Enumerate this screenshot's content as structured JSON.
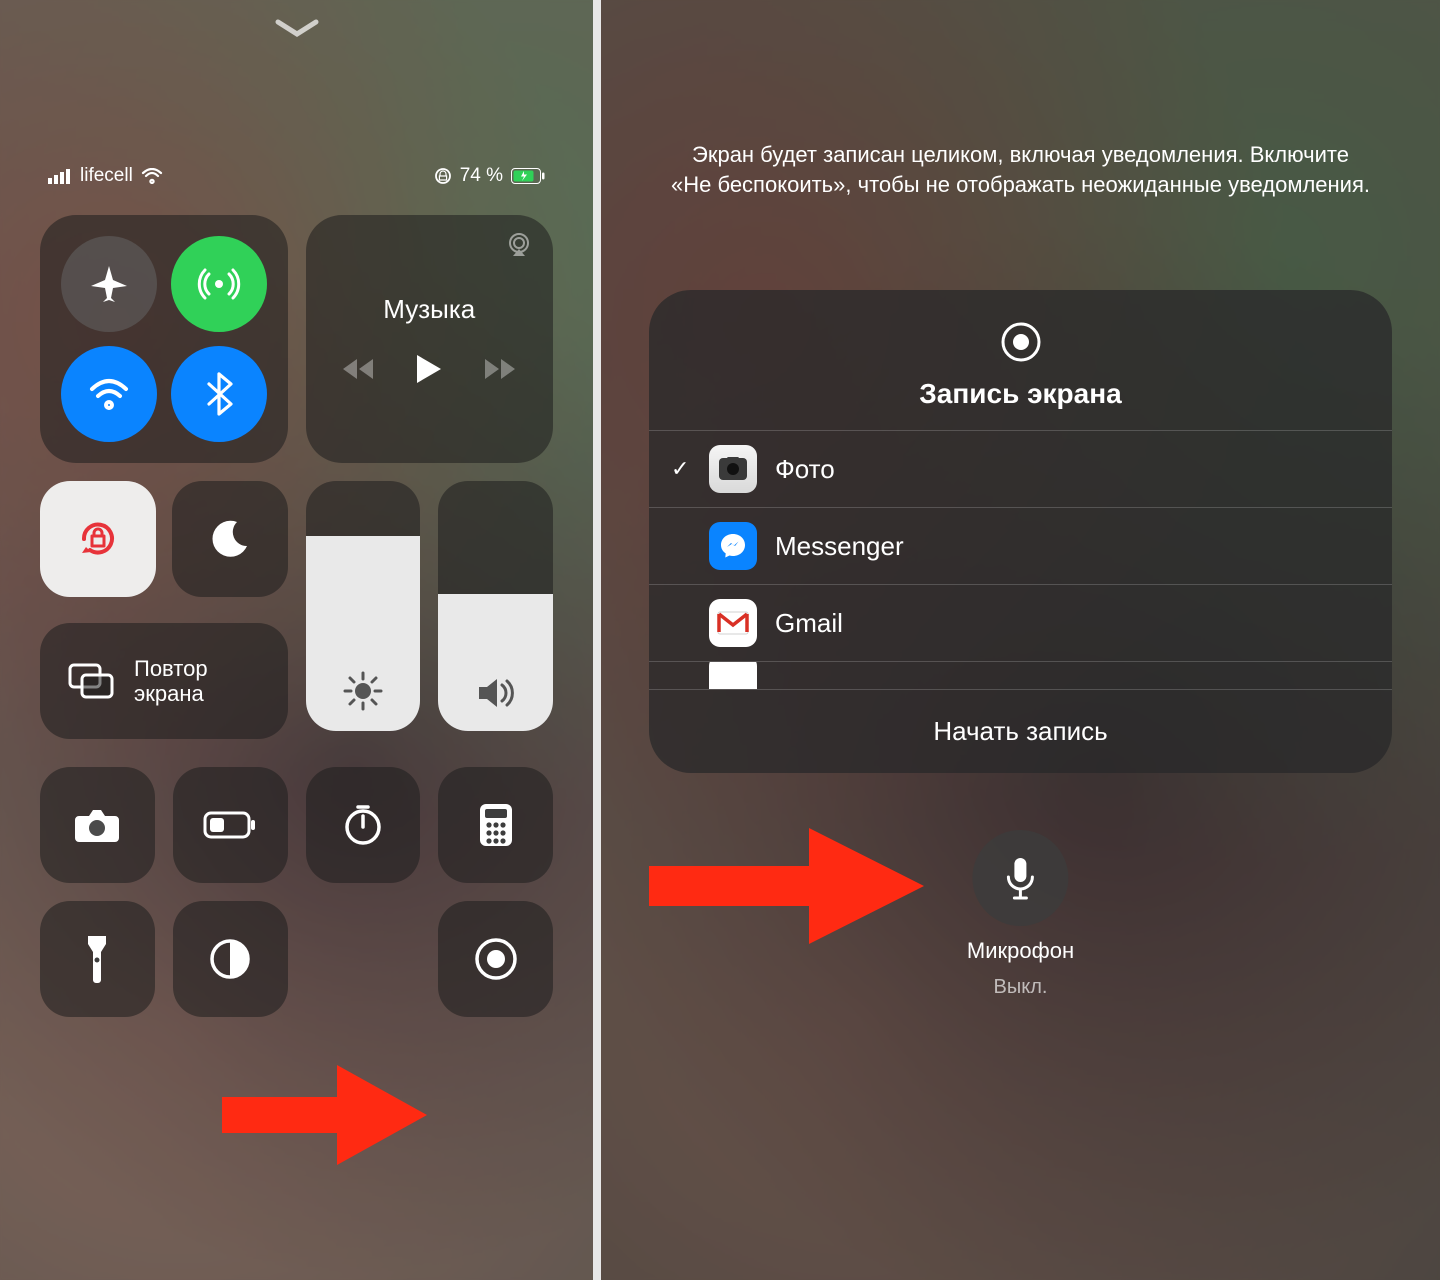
{
  "left": {
    "status": {
      "carrier": "lifecell",
      "battery_pct": "74 %"
    },
    "music": {
      "title": "Музыка"
    },
    "mirror_label": "Повтор\nэкрана",
    "brightness_fill_pct": 78,
    "volume_fill_pct": 55,
    "icons": {
      "airplane": "airplane-icon",
      "cellular": "cellular-icon",
      "wifi": "wifi-icon",
      "bluetooth": "bluetooth-icon",
      "orientation_lock": "orientation-lock-icon",
      "dnd": "dnd-moon-icon",
      "screen_mirror": "screen-mirror-icon",
      "brightness": "brightness-icon",
      "volume": "volume-icon",
      "camera": "camera-icon",
      "low_power": "low-power-icon",
      "timer": "timer-icon",
      "calculator": "calculator-icon",
      "flashlight": "flashlight-icon",
      "dark_mode": "dark-mode-icon",
      "screen_record": "screen-record-icon"
    }
  },
  "right": {
    "info": "Экран будет записан целиком, включая уведомления. Включите «Не беспокоить», чтобы не отображать неожиданные уведомления.",
    "modal": {
      "title": "Запись экрана",
      "destinations": [
        {
          "label": "Фото",
          "selected": true,
          "icon": "photo"
        },
        {
          "label": "Messenger",
          "selected": false,
          "icon": "msgr"
        },
        {
          "label": "Gmail",
          "selected": false,
          "icon": "gmail"
        }
      ],
      "start_label": "Начать запись"
    },
    "mic": {
      "label": "Микрофон",
      "state": "Выкл."
    }
  }
}
